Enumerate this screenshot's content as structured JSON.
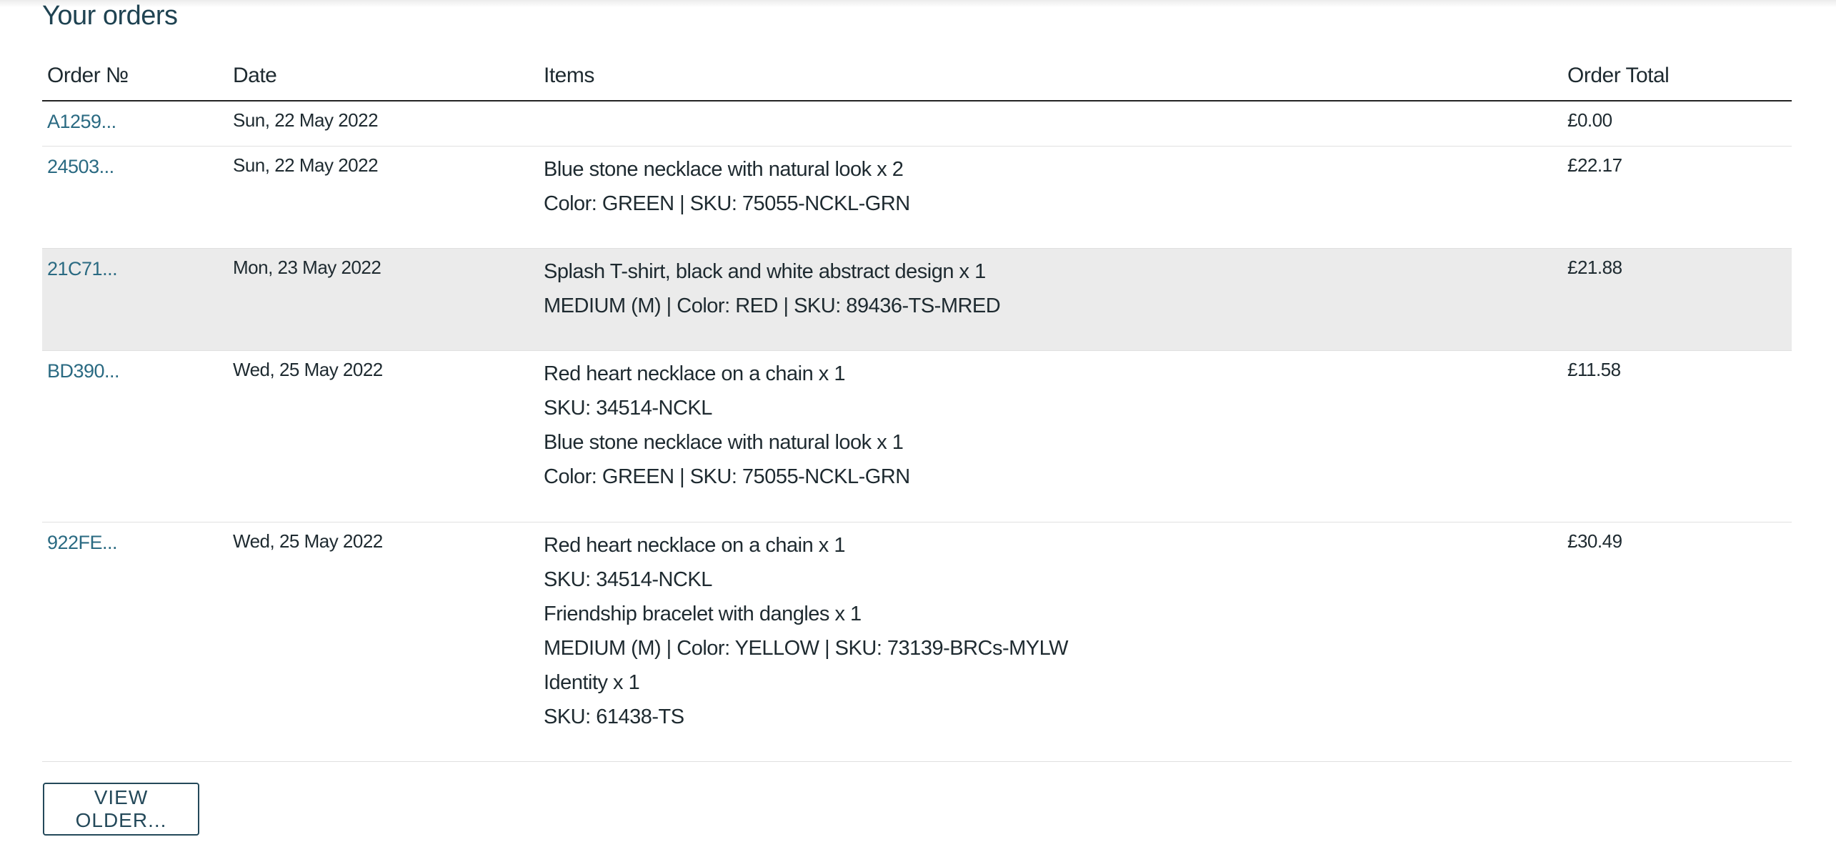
{
  "page": {
    "title": "Your orders"
  },
  "table": {
    "headers": {
      "order_no": "Order №",
      "date": "Date",
      "items": "Items",
      "total": "Order Total"
    },
    "rows": [
      {
        "order_no": "A1259...",
        "date": "Sun, 22 May 2022",
        "items": [],
        "total": "£0.00"
      },
      {
        "order_no": "24503...",
        "date": "Sun, 22 May 2022",
        "items": [
          "Blue stone necklace with natural look x 2",
          "Color: GREEN | SKU: 75055-NCKL-GRN"
        ],
        "total": "£22.17"
      },
      {
        "order_no": "21C71...",
        "date": "Mon, 23 May 2022",
        "items": [
          "Splash T-shirt, black and white abstract design x 1",
          "MEDIUM (M) | Color: RED | SKU: 89436-TS-MRED"
        ],
        "total": "£21.88"
      },
      {
        "order_no": "BD390...",
        "date": "Wed, 25 May 2022",
        "items": [
          "Red heart necklace on a chain x 1",
          "SKU: 34514-NCKL",
          "Blue stone necklace with natural look x 1",
          "Color: GREEN | SKU: 75055-NCKL-GRN"
        ],
        "total": "£11.58"
      },
      {
        "order_no": "922FE...",
        "date": "Wed, 25 May 2022",
        "items": [
          "Red heart necklace on a chain x 1",
          "SKU: 34514-NCKL",
          "Friendship bracelet with dangles x 1",
          "MEDIUM (M) | Color: YELLOW | SKU: 73139-BRCs-MYLW",
          "Identity x 1",
          "SKU: 61438-TS"
        ],
        "total": "£30.49"
      }
    ]
  },
  "actions": {
    "view_older_label": "VIEW OLDER..."
  },
  "colors": {
    "link": "#2a6a82",
    "title": "#1f4352",
    "highlight_row": "#ebebeb",
    "button_border": "#24495a"
  }
}
